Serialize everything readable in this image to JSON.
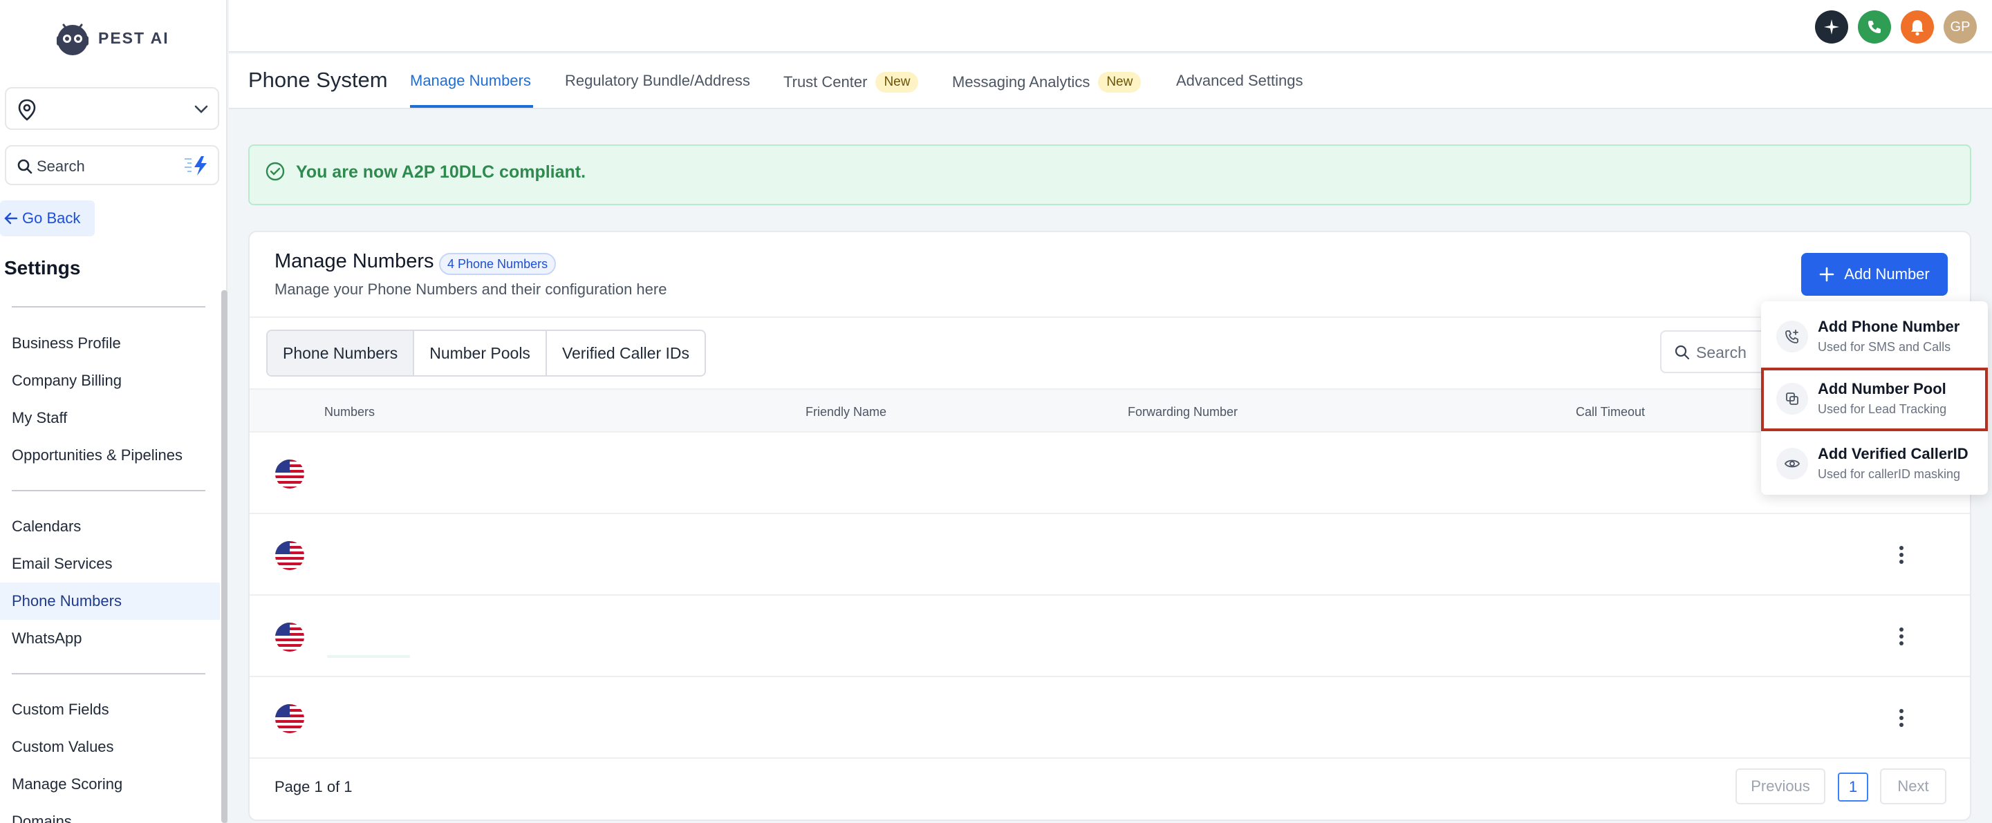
{
  "app": {
    "logo_text": "PEST AI"
  },
  "sidebar": {
    "search_placeholder": "Search",
    "go_back": "Go Back",
    "settings_title": "Settings",
    "items": [
      {
        "label": "Business Profile"
      },
      {
        "label": "Company Billing"
      },
      {
        "label": "My Staff"
      },
      {
        "label": "Opportunities & Pipelines"
      },
      {
        "label": "Calendars"
      },
      {
        "label": "Email Services"
      },
      {
        "label": "Phone Numbers",
        "active": true
      },
      {
        "label": "WhatsApp"
      },
      {
        "label": "Custom Fields"
      },
      {
        "label": "Custom Values"
      },
      {
        "label": "Manage Scoring"
      },
      {
        "label": "Domains"
      }
    ]
  },
  "topbar": {
    "avatar_initials": "GP",
    "icons": [
      "sparkle-icon",
      "phone-icon",
      "bell-icon",
      "avatar"
    ],
    "colors": {
      "sparkle": "#1f2a36",
      "phone": "#2f9e54",
      "bell": "#f0702a",
      "avatar": "#c9a980"
    }
  },
  "header": {
    "title": "Phone System",
    "tabs": [
      {
        "label": "Manage Numbers",
        "active": true
      },
      {
        "label": "Regulatory Bundle/Address"
      },
      {
        "label": "Trust Center",
        "badge": "New"
      },
      {
        "label": "Messaging Analytics",
        "badge": "New"
      },
      {
        "label": "Advanced Settings"
      }
    ]
  },
  "alert": {
    "message": "You are now A2P 10DLC compliant."
  },
  "manage": {
    "title": "Manage Numbers",
    "count_badge": "4 Phone Numbers",
    "subtitle": "Manage your Phone Numbers and their configuration here",
    "add_button": "Add Number",
    "segments": [
      {
        "label": "Phone Numbers",
        "active": true
      },
      {
        "label": "Number Pools"
      },
      {
        "label": "Verified Caller IDs"
      }
    ],
    "search_placeholder": "Search",
    "columns": [
      "Numbers",
      "Friendly Name",
      "Forwarding Number",
      "Call Timeout"
    ],
    "rows": [
      {},
      {},
      {},
      {}
    ],
    "pagination": {
      "info": "Page 1 of 1",
      "previous": "Previous",
      "current": "1",
      "next": "Next"
    }
  },
  "add_menu": {
    "items": [
      {
        "title": "Add Phone Number",
        "subtitle": "Used for SMS and Calls",
        "icon": "phone-plus-icon"
      },
      {
        "title": "Add Number Pool",
        "subtitle": "Used for Lead Tracking",
        "icon": "pool-icon",
        "highlighted": true
      },
      {
        "title": "Add Verified CallerID",
        "subtitle": "Used for callerID masking",
        "icon": "eye-icon"
      }
    ]
  },
  "colors": {
    "accent": "#2563eb",
    "success_text": "#2f8a4f",
    "highlight_border": "#b23121"
  }
}
